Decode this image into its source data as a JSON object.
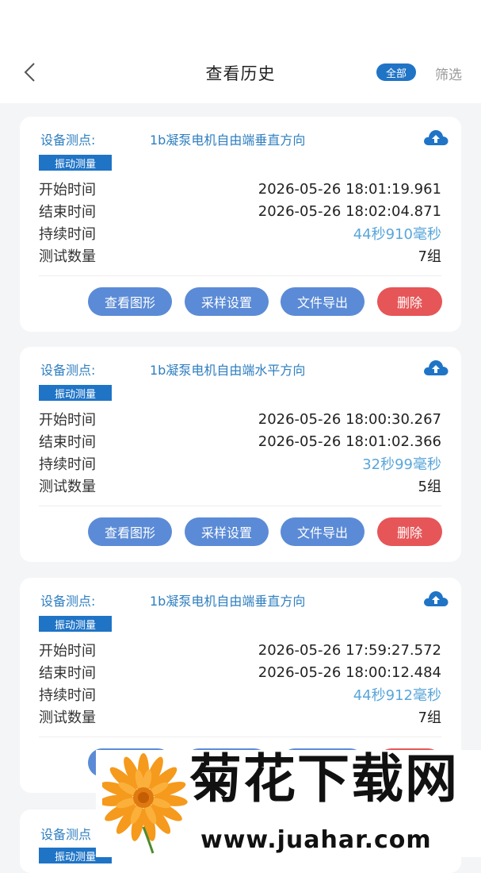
{
  "header": {
    "title": "查看历史",
    "filter_all_label": "全部",
    "filter_label": "筛选"
  },
  "labels": {
    "point": "设备测点:",
    "tag": "振动测量",
    "start": "开始时间",
    "end": "结束时间",
    "duration": "持续时间",
    "count": "测试数量",
    "btn_view": "查看图形",
    "btn_sample": "采样设置",
    "btn_export": "文件导出",
    "btn_delete": "删除"
  },
  "records": [
    {
      "point": "1b凝泵电机自由端垂直方向",
      "start": "2026-05-26 18:01:19.961",
      "end": "2026-05-26 18:02:04.871",
      "duration": "44秒910毫秒",
      "count": "7组"
    },
    {
      "point": "1b凝泵电机自由端水平方向",
      "start": "2026-05-26 18:00:30.267",
      "end": "2026-05-26 18:01:02.366",
      "duration": "32秒99毫秒",
      "count": "5组"
    },
    {
      "point": "1b凝泵电机自由端垂直方向",
      "start": "2026-05-26 17:59:27.572",
      "end": "2026-05-26 18:00:12.484",
      "duration": "44秒912毫秒",
      "count": "7组"
    }
  ],
  "partial_card": {
    "point_label": "设备测点",
    "tag": "振动测量"
  },
  "watermark": {
    "title": "菊花下载网",
    "url": "www.juahar.com"
  },
  "colors": {
    "primary": "#1f74c6",
    "button_blue": "#5b8bd6",
    "button_red": "#e65557",
    "accent_text": "#5aa6da"
  },
  "icons": {
    "back": "chevron-left-icon",
    "upload": "cloud-upload-icon"
  }
}
